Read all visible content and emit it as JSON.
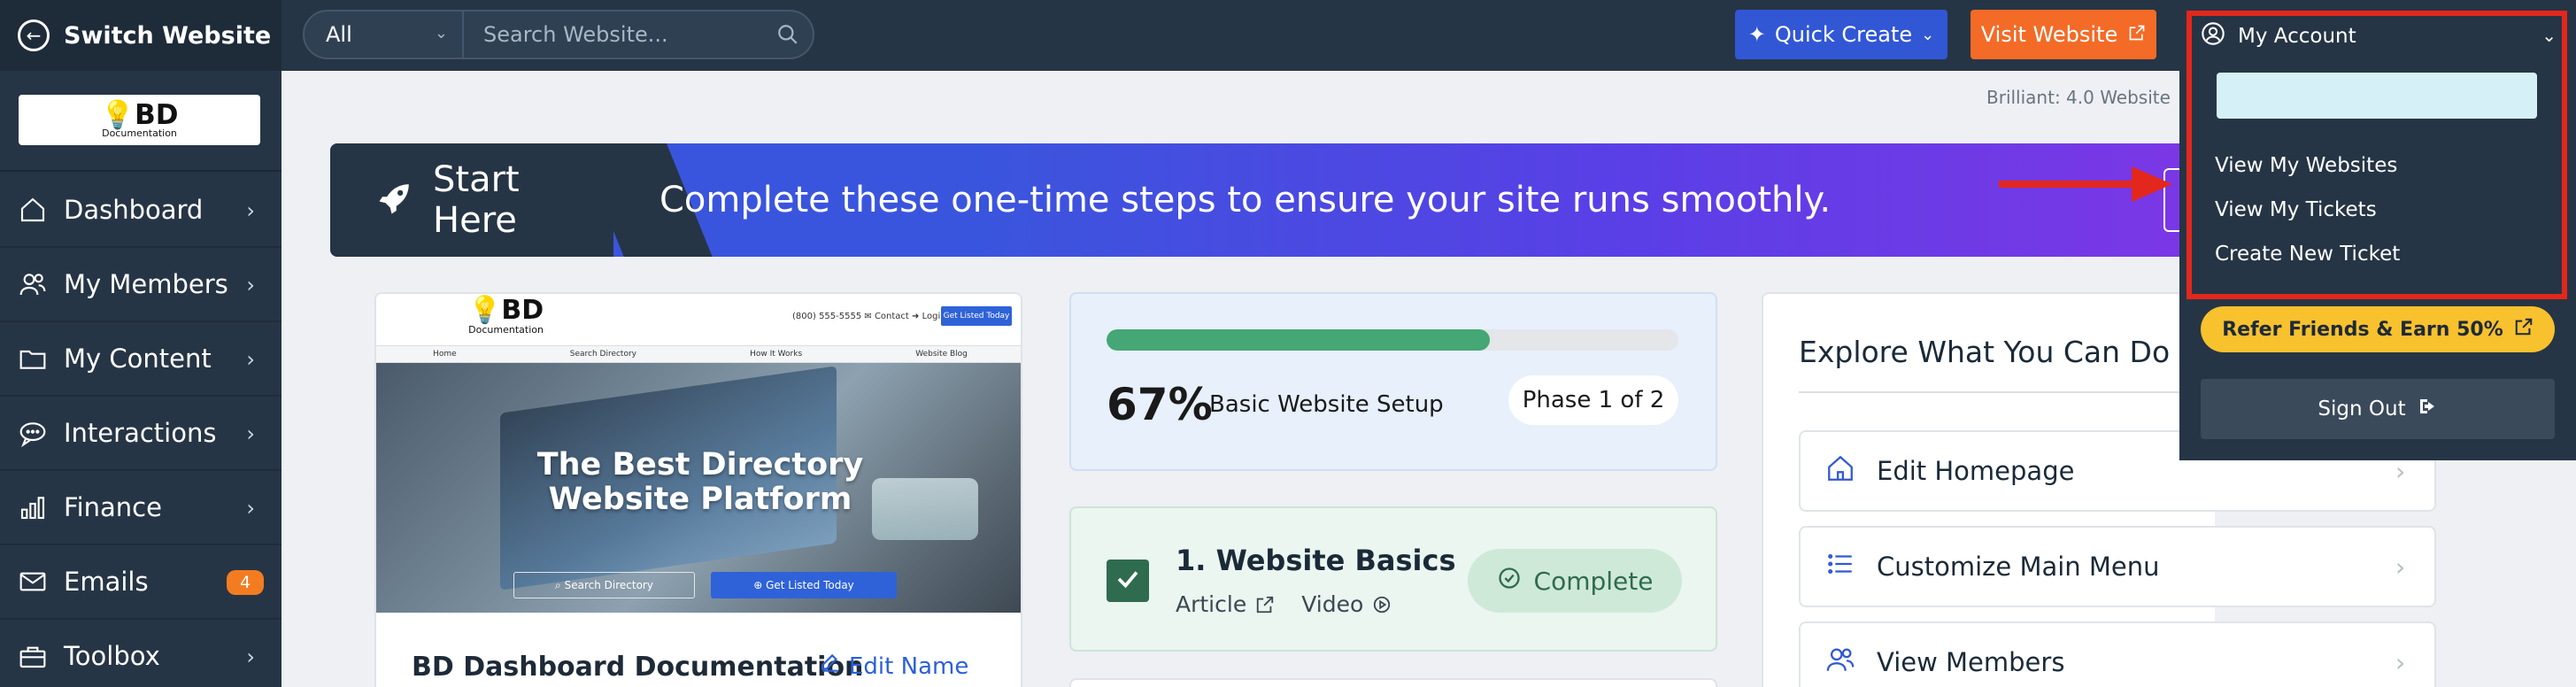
{
  "sidebar": {
    "switch_label": "Switch Website",
    "logo": {
      "text": "BD",
      "subtext": "Documentation"
    },
    "items": [
      {
        "label": "Dashboard",
        "icon": "home-icon"
      },
      {
        "label": "My Members",
        "icon": "users-icon"
      },
      {
        "label": "My Content",
        "icon": "folder-icon"
      },
      {
        "label": "Interactions",
        "icon": "chat-icon"
      },
      {
        "label": "Finance",
        "icon": "bar-chart-icon"
      },
      {
        "label": "Emails",
        "icon": "envelope-icon",
        "badge": "4"
      },
      {
        "label": "Toolbox",
        "icon": "toolbox-icon"
      }
    ]
  },
  "topbar": {
    "search_filter": "All",
    "search_placeholder": "Search Website...",
    "quick_create": "Quick Create",
    "visit_website": "Visit Website"
  },
  "main": {
    "version_text": "Brilliant: 4.0     Website",
    "banner": {
      "label": "Start Here",
      "text": "Complete these one-time steps to ensure your site runs smoothly."
    },
    "preview": {
      "logo": "BD",
      "logo_sub": "Documentation",
      "contact": "(800) 555-5555   ✉ Contact   ➜ Login",
      "get_listed": "Get Listed Today",
      "nav": [
        "Home",
        "Search Directory",
        "How It Works",
        "Website Blog"
      ],
      "hero_title_1": "The Best Directory",
      "hero_title_2": "Website Platform",
      "hero_search": "Search Directory",
      "hero_get_listed": "Get Listed Today",
      "site_name": "BD Dashboard Documentation",
      "edit_name": "Edit Name"
    },
    "progress": {
      "percent_text": "67%",
      "percent_value": 67,
      "label": "Basic Website Setup",
      "phase": "Phase 1 of 2"
    },
    "step": {
      "title": "1. Website Basics",
      "article": "Article",
      "video": "Video",
      "status": "Complete"
    },
    "explore": {
      "title": "Explore What You Can Do",
      "items": [
        {
          "label": "Edit Homepage",
          "icon": "home-icon"
        },
        {
          "label": "Customize Main Menu",
          "icon": "list-icon"
        },
        {
          "label": "View Members",
          "icon": "users-icon"
        }
      ]
    }
  },
  "account": {
    "title": "My Account",
    "links": [
      "View My Websites",
      "View My Tickets",
      "Create New Ticket"
    ],
    "refer": "Refer Friends & Earn 50%",
    "sign_out": "Sign Out"
  },
  "colors": {
    "sidebar_bg": "#263545",
    "accent_blue": "#3157d5",
    "accent_orange": "#f36b27",
    "progress_green": "#45a775",
    "highlight_red": "#e3271d",
    "refer_yellow": "#f8c12e"
  }
}
